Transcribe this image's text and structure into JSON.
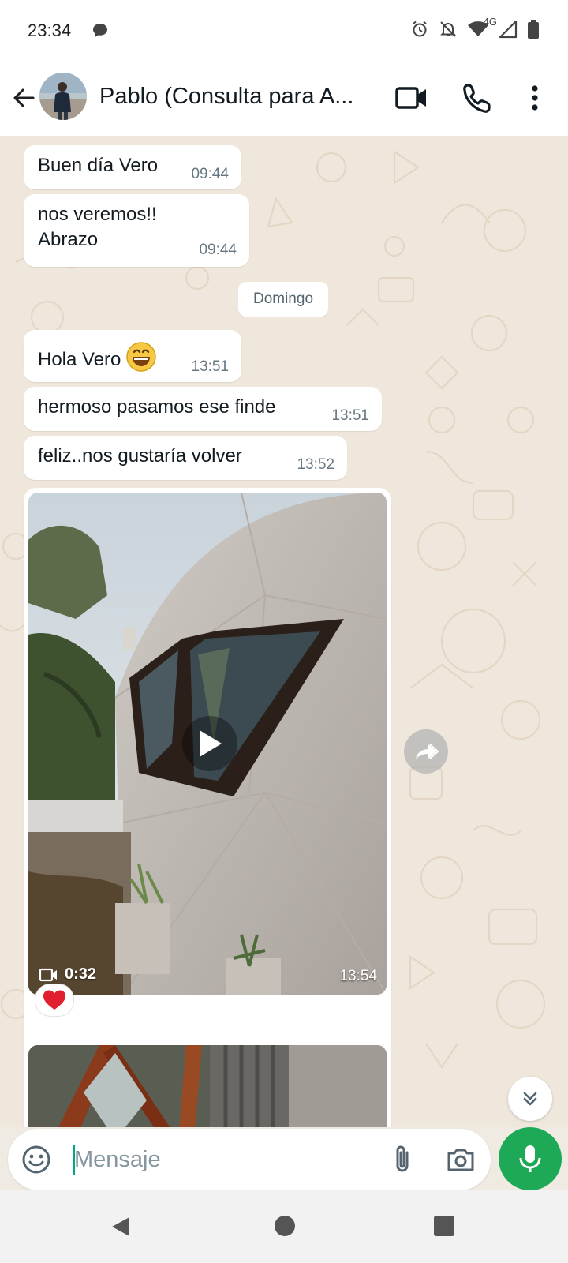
{
  "status_bar": {
    "time": "23:34",
    "network": "4G",
    "icons": [
      "chat-bubble-icon",
      "alarm-icon",
      "notifications-off-icon",
      "wifi-icon",
      "signal-icon",
      "battery-icon"
    ]
  },
  "header": {
    "contact_name": "Pablo (Consulta para A...",
    "actions": [
      "video-call-icon",
      "phone-icon",
      "more-vert-icon"
    ]
  },
  "messages": [
    {
      "text": "Buen día Vero",
      "time": "09:44"
    },
    {
      "text_lines": [
        "nos veremos!!",
        "Abrazo"
      ],
      "time": "09:44"
    },
    {
      "text": "Hola Vero",
      "emoji": "grinning-face-icon",
      "time": "13:51"
    },
    {
      "text": "hermoso pasamos ese finde",
      "time": "13:51"
    },
    {
      "text": "feliz..nos gustaría volver",
      "time": "13:52"
    }
  ],
  "date_separator": "Domingo",
  "video_message": {
    "duration": "0:32",
    "time": "13:54",
    "reaction": "red-heart-icon"
  },
  "composer": {
    "placeholder": "Mensaje"
  },
  "colors": {
    "accent": "#1da955",
    "chat_background": "#efe7dc",
    "bubble": "#ffffff",
    "time_text": "#667781"
  }
}
